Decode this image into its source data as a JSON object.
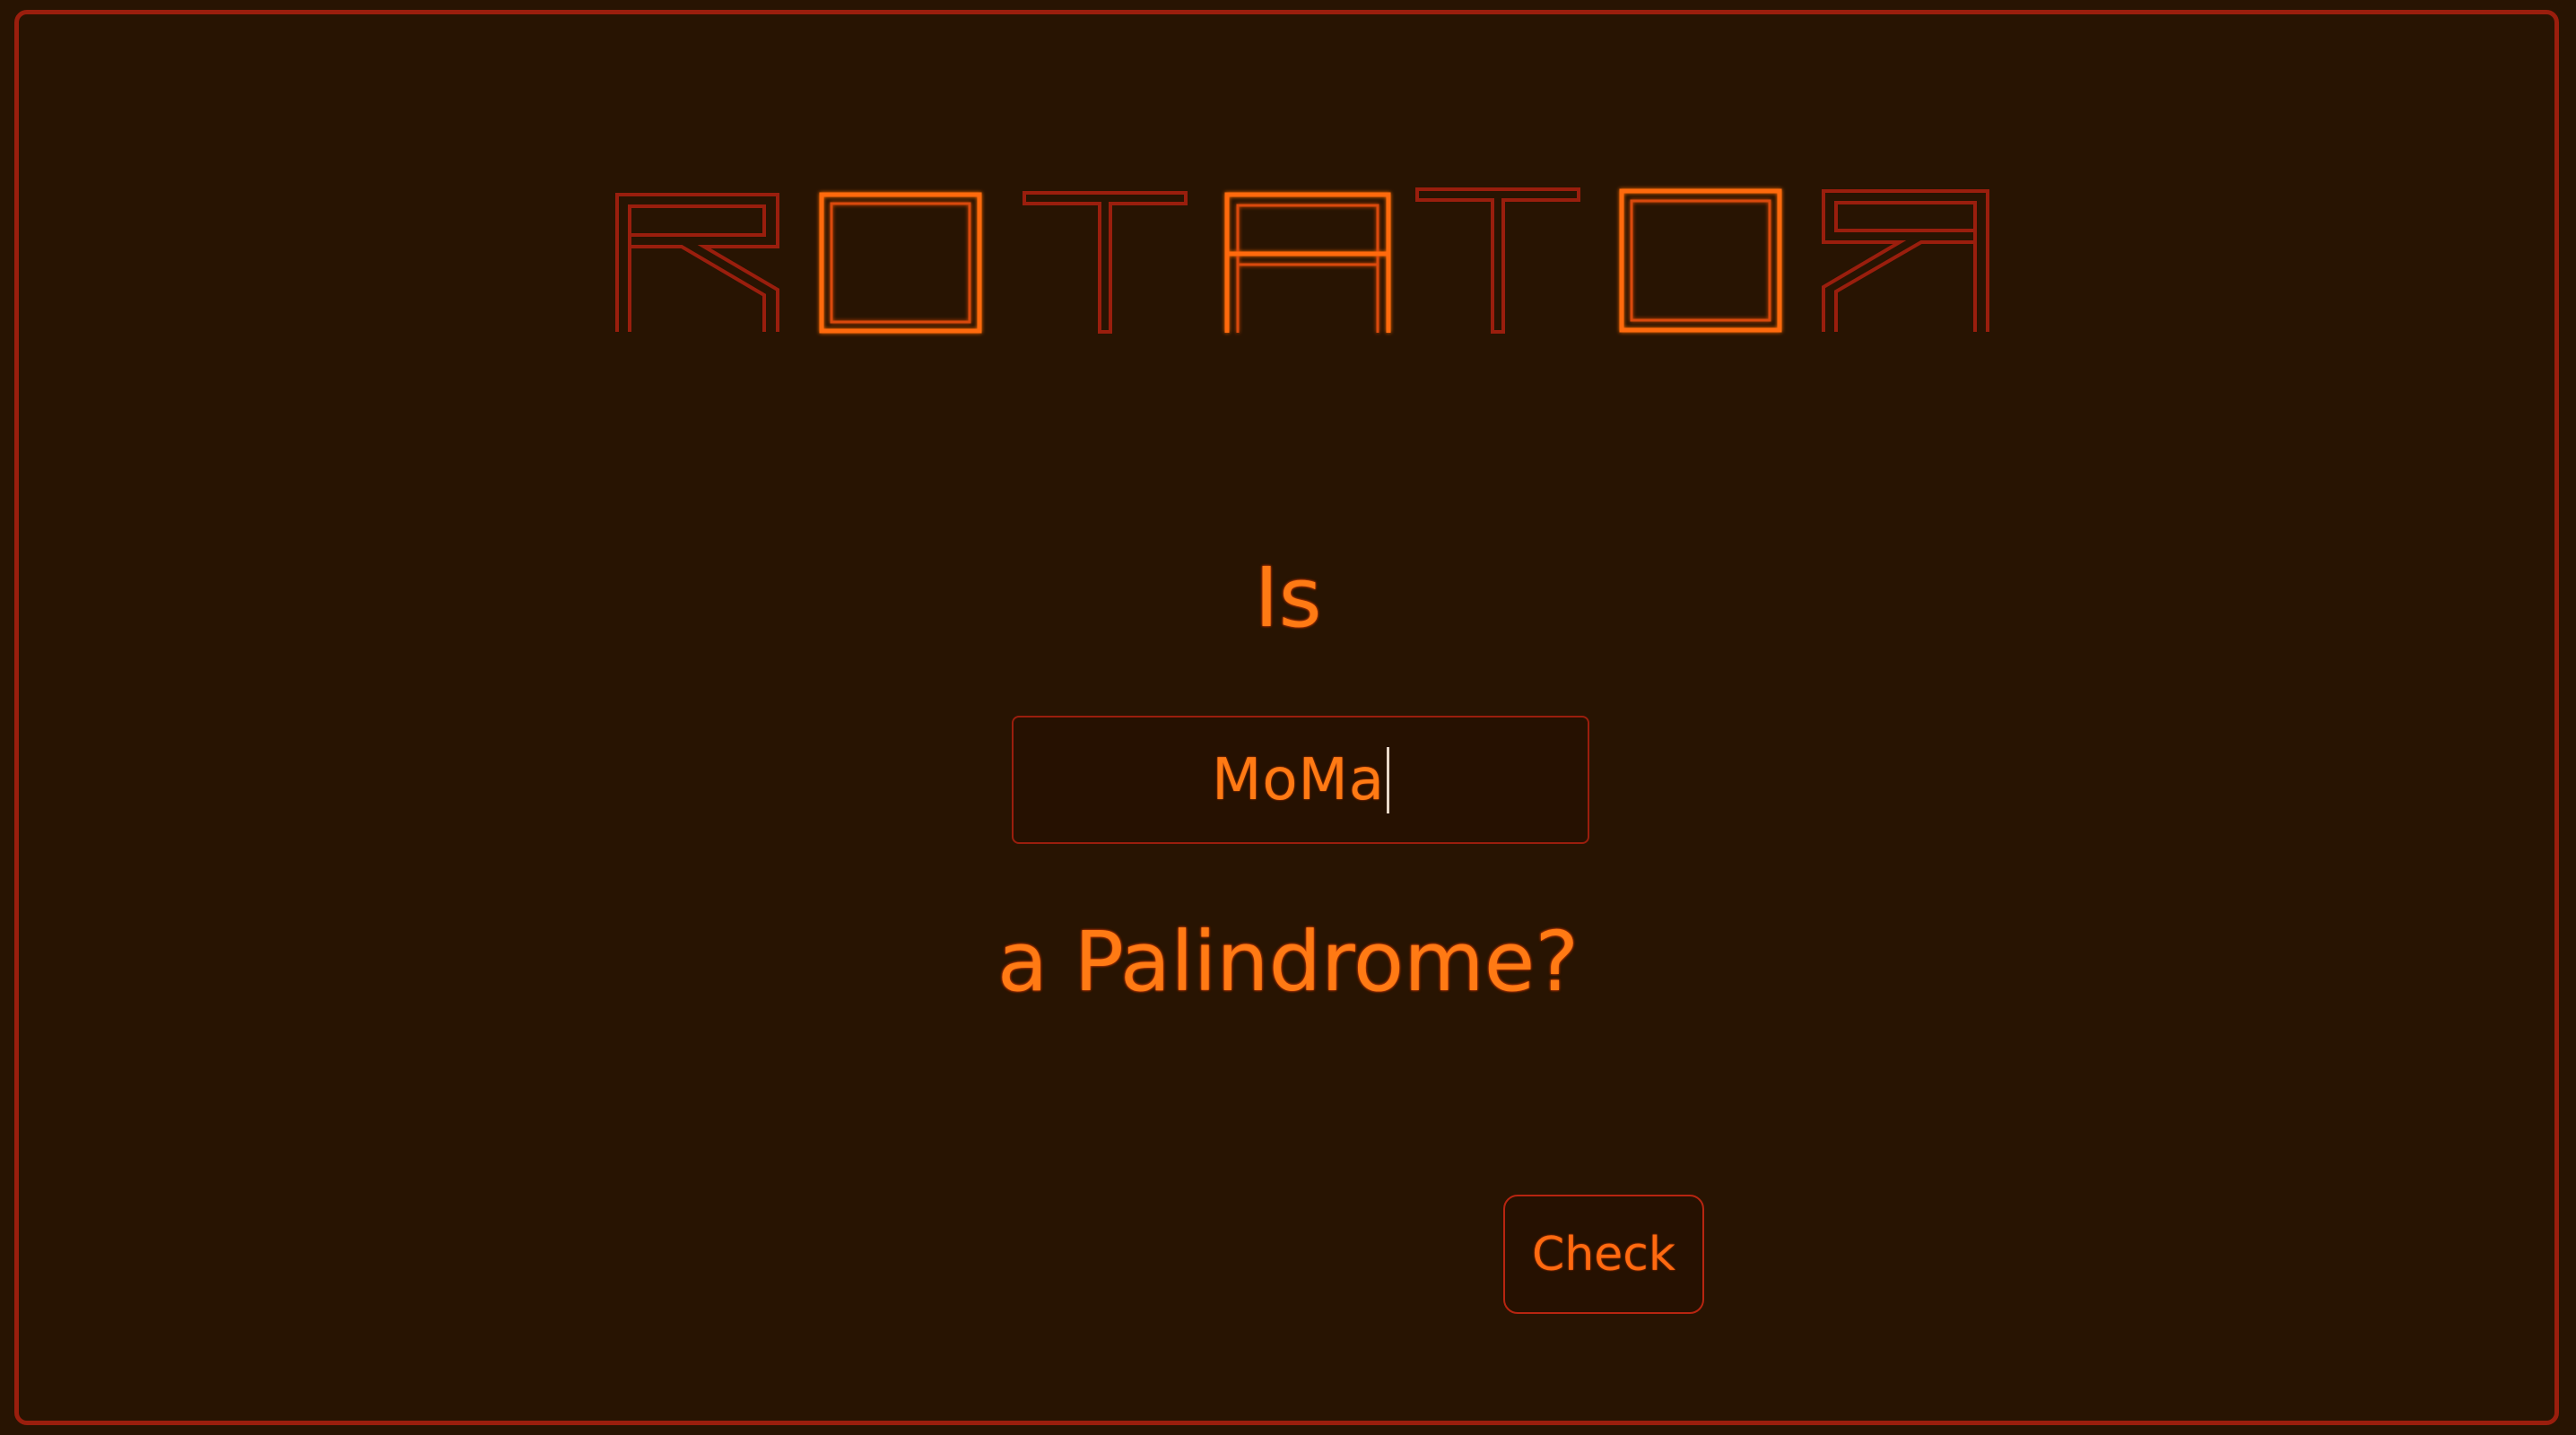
{
  "app": {
    "logo_text": "ROTATOR"
  },
  "prompt": {
    "line1": "Is",
    "line2": "a Palindrome?"
  },
  "input": {
    "value": "MoMa"
  },
  "actions": {
    "check_label": "Check"
  },
  "colors": {
    "background": "#281402",
    "accent": "#ff7a14",
    "border": "#9a1e0d"
  }
}
